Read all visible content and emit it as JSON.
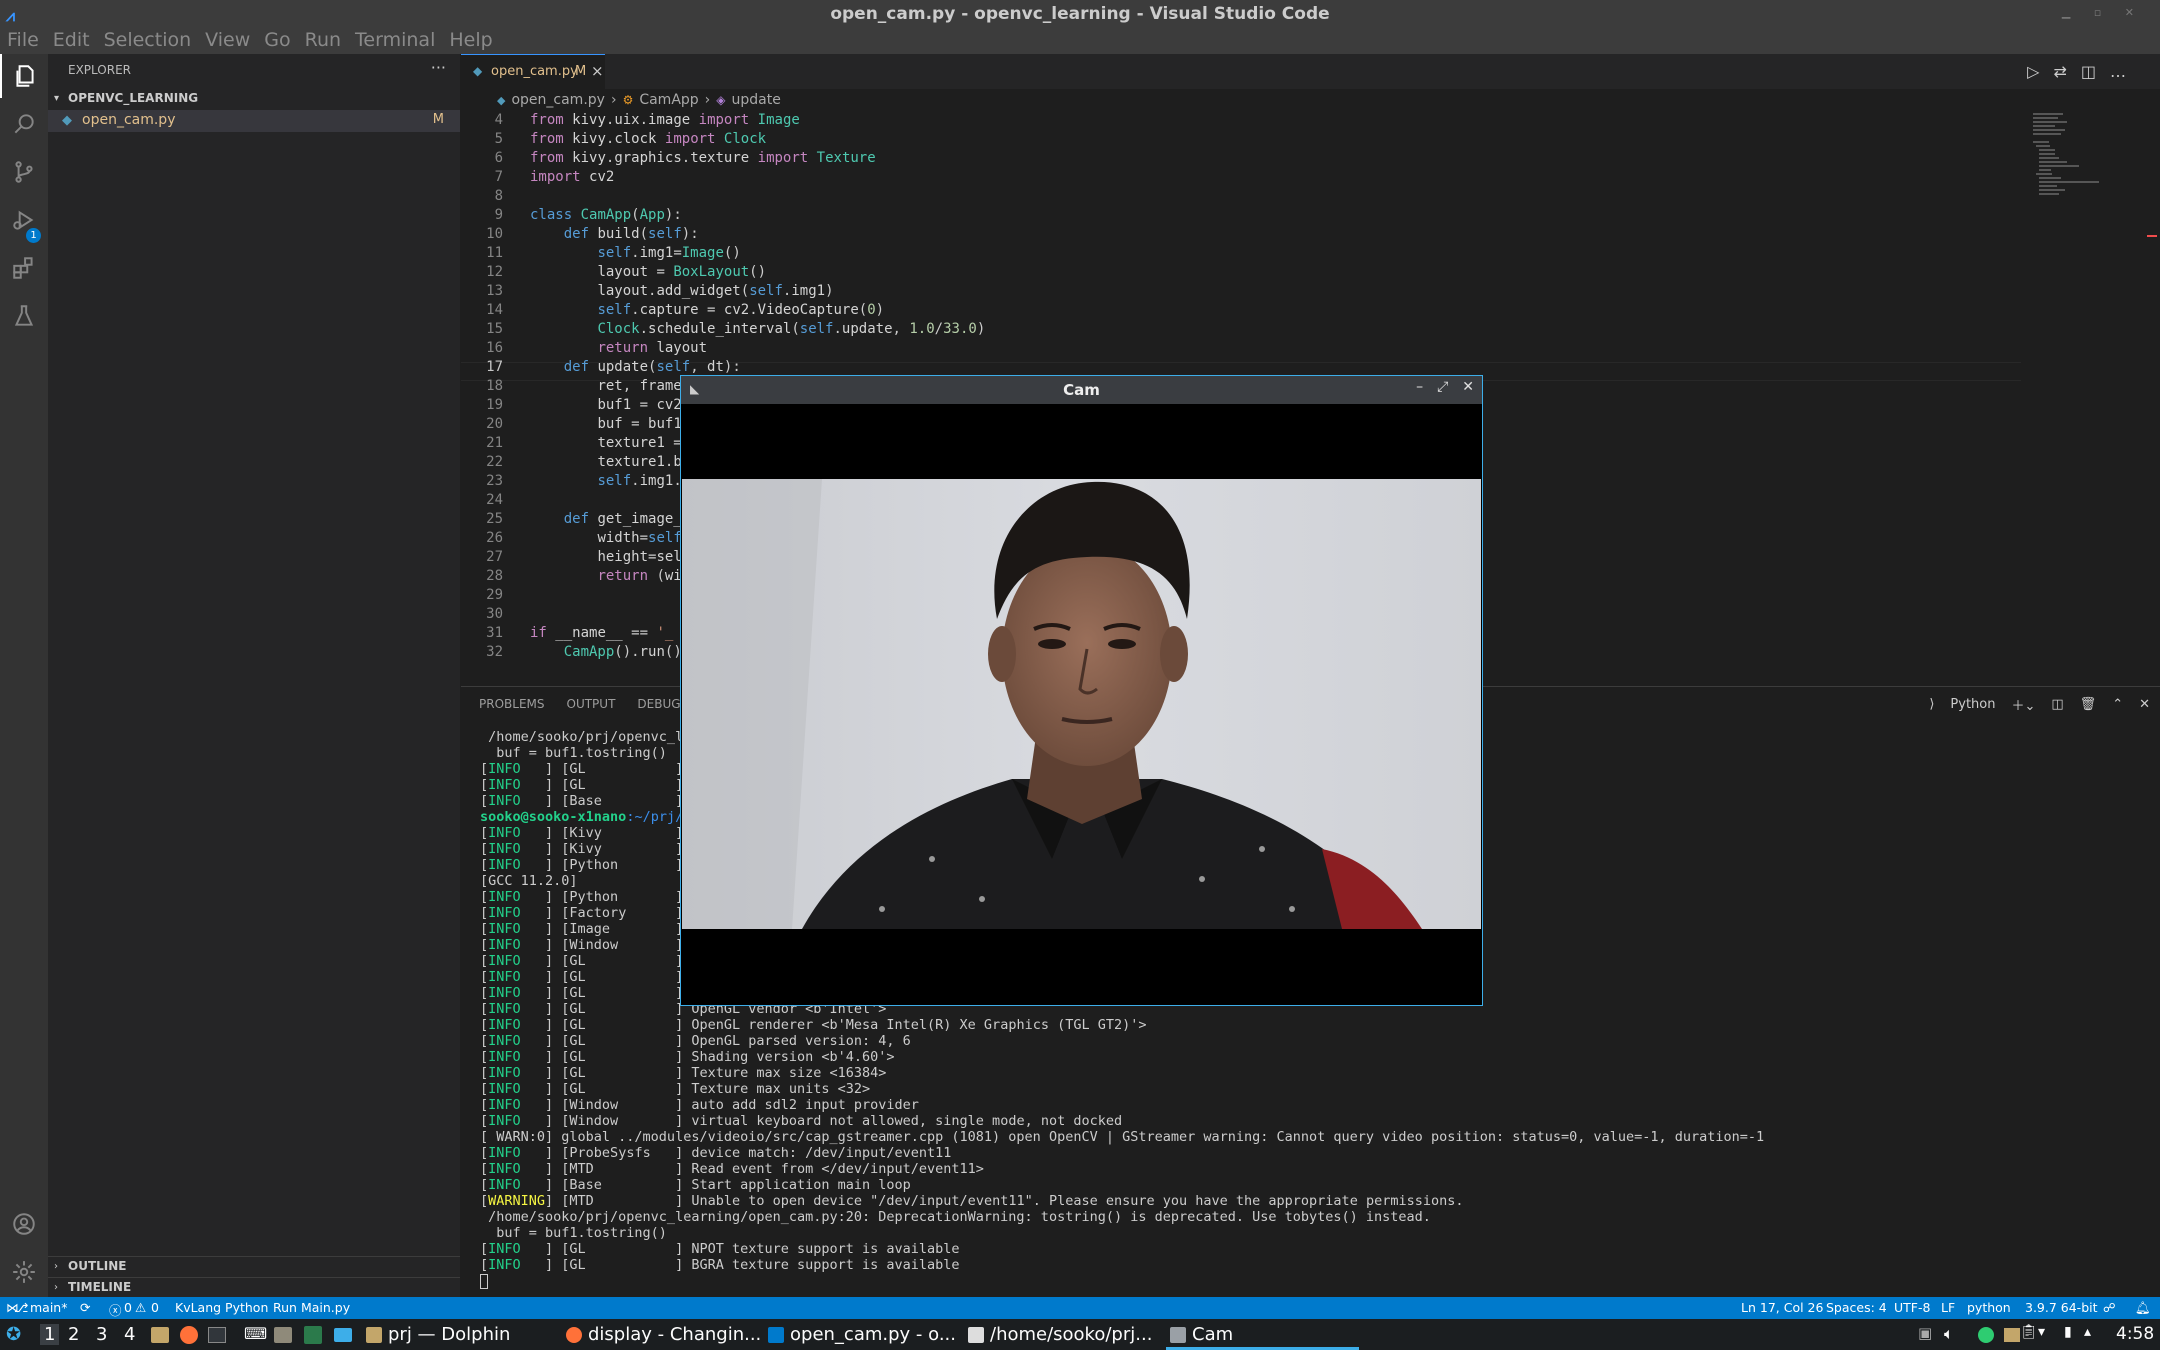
{
  "window": {
    "title": "open_cam.py - openvc_learning - Visual Studio Code",
    "logo": "vscode-logo"
  },
  "menu": [
    "File",
    "Edit",
    "Selection",
    "View",
    "Go",
    "Run",
    "Terminal",
    "Help"
  ],
  "activity_bar": {
    "icons": [
      "explorer-icon",
      "search-icon",
      "source-control-icon",
      "run-debug-icon",
      "extensions-icon",
      "testing-icon",
      "account-icon",
      "settings-gear-icon"
    ],
    "scm_badge": "1"
  },
  "sidebar": {
    "title": "EXPLORER",
    "more": "···",
    "folder": "OPENVC_LEARNING",
    "files": [
      {
        "name": "open_cam.py",
        "badge": "M"
      }
    ],
    "outline": "OUTLINE",
    "timeline": "TIMELINE"
  },
  "editor": {
    "tab": {
      "label": "open_cam.py",
      "badge": "M",
      "close": "×"
    },
    "breadcrumb": [
      "open_cam.py",
      "CamApp",
      "update"
    ],
    "cursor_line": 17,
    "lines": [
      {
        "n": "4",
        "text": "from kivy.uix.image import Image"
      },
      {
        "n": "5",
        "text": "from kivy.clock import Clock"
      },
      {
        "n": "6",
        "text": "from kivy.graphics.texture import Texture"
      },
      {
        "n": "7",
        "text": "import cv2"
      },
      {
        "n": "8",
        "text": ""
      },
      {
        "n": "9",
        "text": "class CamApp(App):"
      },
      {
        "n": "10",
        "text": "    def build(self):"
      },
      {
        "n": "11",
        "text": "        self.img1=Image()"
      },
      {
        "n": "12",
        "text": "        layout = BoxLayout()"
      },
      {
        "n": "13",
        "text": "        layout.add_widget(self.img1)"
      },
      {
        "n": "14",
        "text": "        self.capture = cv2.VideoCapture(0)"
      },
      {
        "n": "15",
        "text": "        Clock.schedule_interval(self.update, 1.0/33.0)"
      },
      {
        "n": "16",
        "text": "        return layout"
      },
      {
        "n": "17",
        "text": "    def update(self, dt):"
      },
      {
        "n": "18",
        "text": "        ret, frame"
      },
      {
        "n": "19",
        "text": "        buf1 = cv2"
      },
      {
        "n": "20",
        "text": "        buf = buf1"
      },
      {
        "n": "21",
        "text": "        texture1 ="
      },
      {
        "n": "22",
        "text": "        texture1.b"
      },
      {
        "n": "23",
        "text": "        self.img1."
      },
      {
        "n": "24",
        "text": ""
      },
      {
        "n": "25",
        "text": "    def get_image_"
      },
      {
        "n": "26",
        "text": "        width=self"
      },
      {
        "n": "27",
        "text": "        height=sel"
      },
      {
        "n": "28",
        "text": "        return (wi"
      },
      {
        "n": "29",
        "text": ""
      },
      {
        "n": "30",
        "text": ""
      },
      {
        "n": "31",
        "text": "if __name__ == '_"
      },
      {
        "n": "32",
        "text": "    CamApp().run()"
      }
    ]
  },
  "panel": {
    "tabs": [
      "PROBLEMS",
      "OUTPUT",
      "DEBUG CO"
    ],
    "terminal_name": "Python",
    "terminal_lines": [
      {
        "t": "plain",
        "text": " /home/sooko/prj/openvc_l"
      },
      {
        "t": "plain",
        "text": "  buf = buf1.tostring()"
      },
      {
        "t": "info",
        "tag": "INFO",
        "text": "   ] [GL           ]"
      },
      {
        "t": "info",
        "tag": "INFO",
        "text": "   ] [GL           ]"
      },
      {
        "t": "info",
        "tag": "INFO",
        "text": "   ] [Base         ]"
      },
      {
        "t": "prompt",
        "user": "sooko@sooko-x1nano",
        "path": ":~/prj/"
      },
      {
        "t": "info",
        "tag": "INFO",
        "text": "   ] [Kivy         ]"
      },
      {
        "t": "info",
        "tag": "INFO",
        "text": "   ] [Kivy         ]"
      },
      {
        "t": "info",
        "tag": "INFO",
        "text": "   ] [Python       ]"
      },
      {
        "t": "plain",
        "text": "[GCC 11.2.0]"
      },
      {
        "t": "info",
        "tag": "INFO",
        "text": "   ] [Python       ]"
      },
      {
        "t": "info",
        "tag": "INFO",
        "text": "   ] [Factory      ]"
      },
      {
        "t": "info",
        "tag": "INFO",
        "text": "   ] [Image        ]"
      },
      {
        "t": "info",
        "tag": "INFO",
        "text": "   ] [Window       ]"
      },
      {
        "t": "info",
        "tag": "INFO",
        "text": "   ] [GL           ]"
      },
      {
        "t": "info",
        "tag": "INFO",
        "text": "   ] [GL           ]"
      },
      {
        "t": "info",
        "tag": "INFO",
        "text": "   ] [GL           ]"
      },
      {
        "t": "info",
        "tag": "INFO",
        "text": "   ] [GL           ] OpenGL vendor <b'Intel'>"
      },
      {
        "t": "info",
        "tag": "INFO",
        "text": "   ] [GL           ] OpenGL renderer <b'Mesa Intel(R) Xe Graphics (TGL GT2)'>"
      },
      {
        "t": "info",
        "tag": "INFO",
        "text": "   ] [GL           ] OpenGL parsed version: 4, 6"
      },
      {
        "t": "info",
        "tag": "INFO",
        "text": "   ] [GL           ] Shading version <b'4.60'>"
      },
      {
        "t": "info",
        "tag": "INFO",
        "text": "   ] [GL           ] Texture max size <16384>"
      },
      {
        "t": "info",
        "tag": "INFO",
        "text": "   ] [GL           ] Texture max units <32>"
      },
      {
        "t": "info",
        "tag": "INFO",
        "text": "   ] [Window       ] auto add sdl2 input provider"
      },
      {
        "t": "info",
        "tag": "INFO",
        "text": "   ] [Window       ] virtual keyboard not allowed, single mode, not docked"
      },
      {
        "t": "plain",
        "text": "[ WARN:0] global ../modules/videoio/src/cap_gstreamer.cpp (1081) open OpenCV | GStreamer warning: Cannot query video position: status=0, value=-1, duration=-1"
      },
      {
        "t": "info",
        "tag": "INFO",
        "text": "   ] [ProbeSysfs   ] device match: /dev/input/event11"
      },
      {
        "t": "info",
        "tag": "INFO",
        "text": "   ] [MTD          ] Read event from </dev/input/event11>"
      },
      {
        "t": "info",
        "tag": "INFO",
        "text": "   ] [Base         ] Start application main loop"
      },
      {
        "t": "warning",
        "tag": "WARNING",
        "text": "] [MTD          ] Unable to open device \"/dev/input/event11\". Please ensure you have the appropriate permissions."
      },
      {
        "t": "plain",
        "text": " /home/sooko/prj/openvc_learning/open_cam.py:20: DeprecationWarning: tostring() is deprecated. Use tobytes() instead."
      },
      {
        "t": "plain",
        "text": "  buf = buf1.tostring()"
      },
      {
        "t": "info",
        "tag": "INFO",
        "text": "   ] [GL           ] NPOT texture support is available"
      },
      {
        "t": "info",
        "tag": "INFO",
        "text": "   ] [GL           ] BGRA texture support is available"
      }
    ]
  },
  "statusbar": {
    "branch": "main*",
    "errors": "0",
    "warnings": "0",
    "kvlang": "KvLang Python",
    "run": "Run Main.py",
    "position": "Ln 17, Col 26",
    "spaces": "Spaces: 4",
    "encoding": "UTF-8",
    "eol": "LF",
    "language": "python",
    "interpreter": "3.9.7 64-bit"
  },
  "taskbar": {
    "desktops": [
      "1",
      "2",
      "3",
      "4"
    ],
    "tasks": [
      "prj — Dolphin",
      "display - Changin...",
      "open_cam.py - o...",
      "/home/sooko/prj...",
      "Cam"
    ],
    "clock": "4:58"
  },
  "cam_window": {
    "title": "Cam"
  },
  "colors": {
    "accent": "#007acc",
    "modified": "#e2c08d",
    "info_green": "#23d18b",
    "warning_yellow": "#f5f543"
  }
}
